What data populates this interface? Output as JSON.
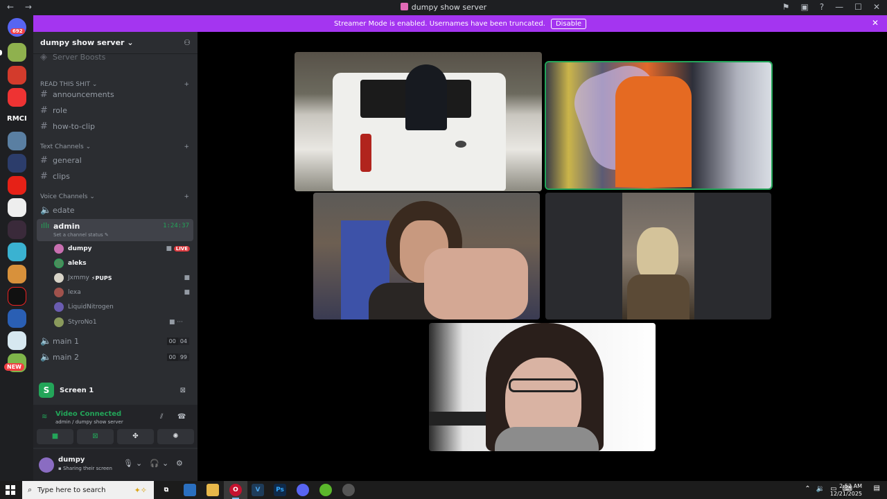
{
  "window": {
    "title": "dumpy show server",
    "nav_arrows": "← →",
    "icons": [
      "inbox-flag-icon",
      "window-icon",
      "help-icon"
    ],
    "controls": [
      "—",
      "☐",
      "✕"
    ]
  },
  "rail": {
    "mention_badge": "692",
    "text_guild": "RMCI",
    "new_badge": "NEW"
  },
  "banner": {
    "text": "Streamer Mode is enabled. Usernames have been truncated.",
    "button": "Disable",
    "color": "#a435f0"
  },
  "server": {
    "name": "dumpy show server",
    "partial_item": "Server Boosts"
  },
  "categories": [
    {
      "label": "READ THIS SHIT",
      "channels": [
        "announcements",
        "role",
        "how-to-clip"
      ]
    },
    {
      "label": "Text Channels",
      "channels": [
        "general",
        "clips"
      ]
    },
    {
      "label": "Voice Channels",
      "channels": [
        "edate"
      ]
    }
  ],
  "voice": {
    "active_channel": "admin",
    "timer": "1:24:37",
    "status_prompt": "Set a channel status",
    "members": [
      {
        "name": "dumpy",
        "live": "LIVE"
      },
      {
        "name": "aleks"
      },
      {
        "name": "Jxmmy",
        "tag": "PUPS"
      },
      {
        "name": "lexa"
      },
      {
        "name": "LiquidNitrogen"
      },
      {
        "name": "StyroNo1"
      }
    ],
    "other_channels": [
      {
        "name": "main 1",
        "count_a": "00",
        "count_b": "04"
      },
      {
        "name": "main 2",
        "count_a": "00",
        "count_b": "99"
      }
    ]
  },
  "screen_share": {
    "label": "Screen 1"
  },
  "rtc": {
    "status": "Video Connected",
    "path": "admin / dumpy show server"
  },
  "user": {
    "name": "dumpy",
    "status": "Sharing their screen"
  },
  "taskbar": {
    "search_placeholder": "Type here to search",
    "time": "2:52 AM",
    "date": "12/21/2025"
  },
  "colors": {
    "accent_green": "#23a559",
    "live_red": "#da373c",
    "sidebar_bg": "#2b2d31"
  }
}
